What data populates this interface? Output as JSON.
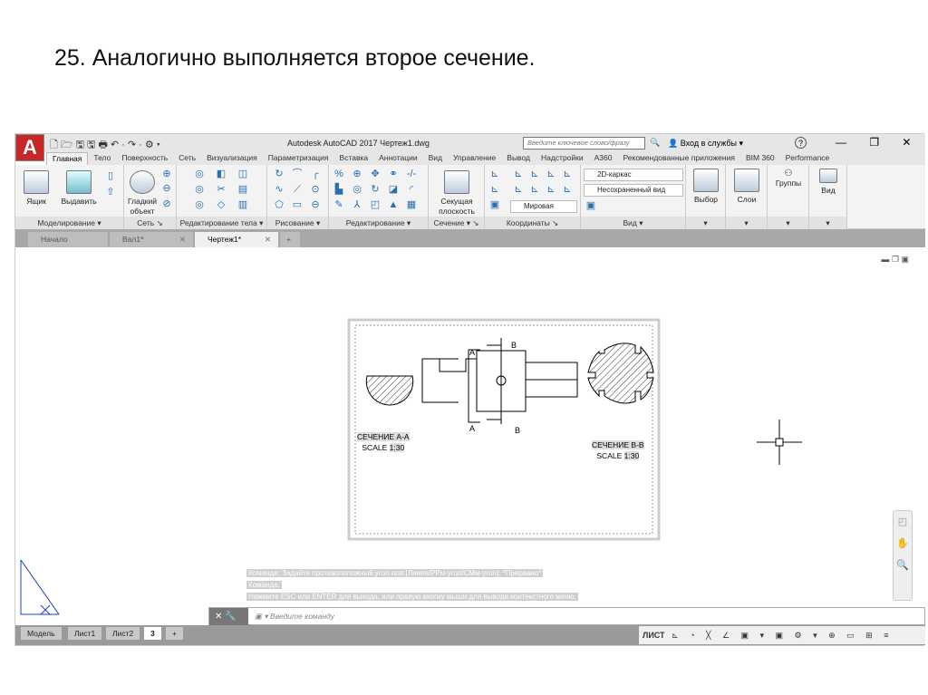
{
  "slide_title": "25. Аналогично выполняется второе сечение.",
  "app": {
    "title": "Autodesk AutoCAD 2017   Чертеж1.dwg",
    "search_placeholder": "Введите ключевое слово/фразу",
    "login": "Вход в службы",
    "help": "?"
  },
  "ribbon_tabs": [
    "Главная",
    "Тело",
    "Поверхность",
    "Сеть",
    "Визуализация",
    "Параметризация",
    "Вставка",
    "Аннотации",
    "Вид",
    "Управление",
    "Вывод",
    "Надстройки",
    "A360",
    "Рекомендованные приложения",
    "BIM 360",
    "Performance"
  ],
  "active_tab": "Главная",
  "panels": {
    "modeling": {
      "label": "Моделирование",
      "box": "Ящик",
      "extrude": "Выдавить"
    },
    "mesh": {
      "label": "Сеть",
      "smooth": "Гладкий объект"
    },
    "solid_edit": {
      "label": "Редактирование тела"
    },
    "draw": {
      "label": "Рисование"
    },
    "modify": {
      "label": "Редактирование"
    },
    "section": {
      "label": "Сечение",
      "plane": "Секущая плоскость"
    },
    "coords": {
      "label": "Координаты",
      "ucs": "Мировая"
    },
    "view": {
      "label": "Вид",
      "visual_style": "2D-каркас",
      "named_view": "Несохраненный вид"
    },
    "select": {
      "label": "Выбор"
    },
    "layers": {
      "label": "Слои"
    },
    "groups": {
      "label": "Группы"
    },
    "view2": {
      "label": "Вид"
    }
  },
  "file_tabs": [
    {
      "label": "Начало",
      "active": false
    },
    {
      "label": "Вал1*",
      "active": false
    },
    {
      "label": "Чертеж1*",
      "active": true
    }
  ],
  "drawing": {
    "section_a_title": "СЕЧЕНИЕ А-А",
    "section_a_scale_label": "SCALE",
    "section_a_scale": "1:30",
    "section_b_title": "СЕЧЕНИЕ В-В",
    "section_b_scale_label": "SCALE",
    "section_b_scale": "1:30",
    "cut_a": "A",
    "cut_b": "B"
  },
  "command_history": [
    "Команда: Задайте противоположный угол или [Линия/РРм-угол/СМм-угол]: *Прервано*",
    "Команда:",
    "Нажмите ESC или ENTER для выхода, или правую кнопку мыши для вывода контекстного меню."
  ],
  "command_placeholder": "Введите команду",
  "layout_tabs": [
    "Модель",
    "Лист1",
    "Лист2",
    "3"
  ],
  "active_layout": "3",
  "status": {
    "space": "ЛИСТ"
  }
}
